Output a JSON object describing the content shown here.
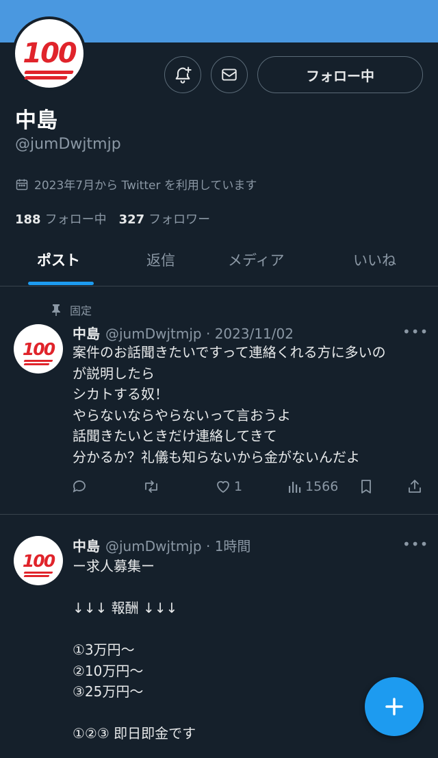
{
  "colors": {
    "background": "#15202b",
    "banner": "#4a98e0",
    "accent": "#1d9bf0",
    "secondary_text": "#8b98a5"
  },
  "profile": {
    "name": "中島",
    "handle": "@jumDwjtmjp",
    "avatar_emoji": "100",
    "joined": "2023年7月から Twitter を利用しています",
    "following_count": "188",
    "following_label": "フォロー中",
    "followers_count": "327",
    "followers_label": "フォロワー",
    "follow_button": "フォロー中",
    "icons": {
      "notify": "bell-plus-icon",
      "message": "envelope-icon",
      "calendar": "calendar-icon"
    }
  },
  "tabs": [
    {
      "label": "ポスト",
      "active": true
    },
    {
      "label": "返信",
      "active": false
    },
    {
      "label": "メディア",
      "active": false
    },
    {
      "label": "いいね",
      "active": false
    }
  ],
  "tweets": [
    {
      "pinned_label": "固定",
      "name": "中島",
      "handle": "@jumDwjtmjp",
      "time": "2023/11/02",
      "more": "•••",
      "text": "案件のお話聞きたいですって連絡くれる方に多いの\nが説明したら\nシカトする奴！\nやらないならやらないって言おうよ\n話聞きたいときだけ連絡してきて\n分かるか？礼儀も知らないから金がないんだよ",
      "likes": "1",
      "views": "1566"
    },
    {
      "name": "中島",
      "handle": "@jumDwjtmjp",
      "time": "1時間",
      "more": "•••",
      "text": "ー求人募集ー\n\n↓↓↓ 報酬 ↓↓↓\n\n①3万円〜\n②10万円〜\n③25万円〜\n\n①②③ 即日即金です"
    }
  ],
  "fab": {
    "icon": "plus-icon",
    "label": "+"
  }
}
